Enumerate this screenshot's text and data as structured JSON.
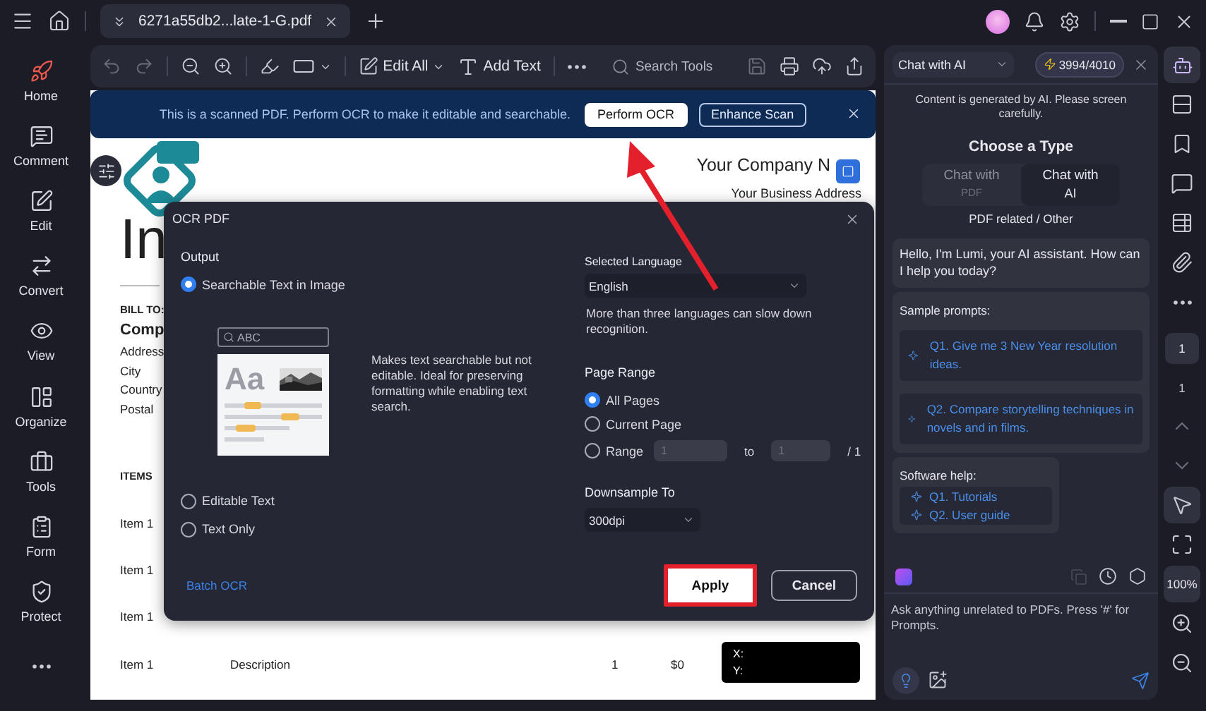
{
  "title_bar": {
    "tab": {
      "label": "6271a55db2...late-1-G.pdf"
    }
  },
  "sidebar": {
    "items": [
      {
        "label": "Home"
      },
      {
        "label": "Comment"
      },
      {
        "label": "Edit"
      },
      {
        "label": "Convert"
      },
      {
        "label": "View"
      },
      {
        "label": "Organize"
      },
      {
        "label": "Tools"
      },
      {
        "label": "Form"
      },
      {
        "label": "Protect"
      }
    ]
  },
  "toolbar": {
    "edit_all": "Edit All",
    "add_text": "Add Text",
    "search_placeholder": "Search Tools"
  },
  "banner": {
    "message": "This is a scanned PDF. Perform OCR to make it editable and searchable.",
    "buttons": [
      {
        "label": "Perform OCR",
        "kind": "filled"
      },
      {
        "label": "Enhance Scan",
        "kind": "outline"
      }
    ]
  },
  "document": {
    "company": "Your Company N",
    "address": "Your Business Address",
    "title": "In",
    "bill_to": "BILL TO:",
    "client": "Comp",
    "client_lines": [
      "Address",
      "City",
      "Country",
      "Postal"
    ],
    "items_heading": "ITEMS",
    "rows": [
      {
        "item": "Item 1"
      },
      {
        "item": "Item 1"
      },
      {
        "item": "Item 1"
      },
      {
        "item": "Item 1",
        "description": "Description",
        "qty": "1",
        "price": "$0"
      }
    ],
    "coordinates": {
      "x": "X:",
      "y": "Y:"
    }
  },
  "dialog": {
    "title": "OCR PDF",
    "output_heading": "Output",
    "output_options": [
      {
        "label": "Searchable Text in Image",
        "selected": true
      },
      {
        "label": "Editable Text",
        "selected": false
      },
      {
        "label": "Text Only",
        "selected": false
      }
    ],
    "preview": {
      "search": "ABC",
      "sample": "Aa"
    },
    "description": "Makes text searchable but not editable. Ideal for preserving formatting while enabling text search.",
    "language_label": "Selected Language",
    "language": "English",
    "language_note": "More than three languages can slow down recognition.",
    "page_range_heading": "Page Range",
    "page_options": [
      {
        "label": "All Pages",
        "selected": true
      },
      {
        "label": "Current Page",
        "selected": false
      },
      {
        "label": "Range",
        "selected": false
      }
    ],
    "range": {
      "from": "1",
      "to_label": "to",
      "to": "1",
      "total": "/ 1"
    },
    "downsample_label": "Downsample To",
    "downsample": "300dpi",
    "batch_link": "Batch OCR",
    "buttons": [
      {
        "label": "Apply",
        "kind": "primary",
        "highlighted": true
      },
      {
        "label": "Cancel",
        "kind": "secondary",
        "highlighted": false
      }
    ]
  },
  "chat": {
    "mode": "Chat with AI",
    "credits": "3994/4010",
    "notice": "Content is generated by AI. Please screen carefully.",
    "type_heading": "Choose a Type",
    "types": [
      {
        "label": "Chat with",
        "sub": "PDF",
        "selected": false
      },
      {
        "label": "Chat with",
        "sub": "AI",
        "selected": true
      }
    ],
    "type_hint": "PDF related / Other",
    "greeting": "Hello, I'm Lumi, your AI assistant. How can I help you today?",
    "sample_heading": "Sample prompts:",
    "samples": [
      "Q1. Give me 3 New Year resolution ideas.",
      "Q2. Compare storytelling techniques in novels and in films."
    ],
    "help_heading": "Software help:",
    "help_items": [
      "Q1. Tutorials",
      "Q2. User guide"
    ],
    "input_placeholder": "Ask anything unrelated to PDFs. Press '#' for Prompts."
  },
  "right_bar": {
    "page": "1",
    "total": "1",
    "zoom": "100%"
  }
}
